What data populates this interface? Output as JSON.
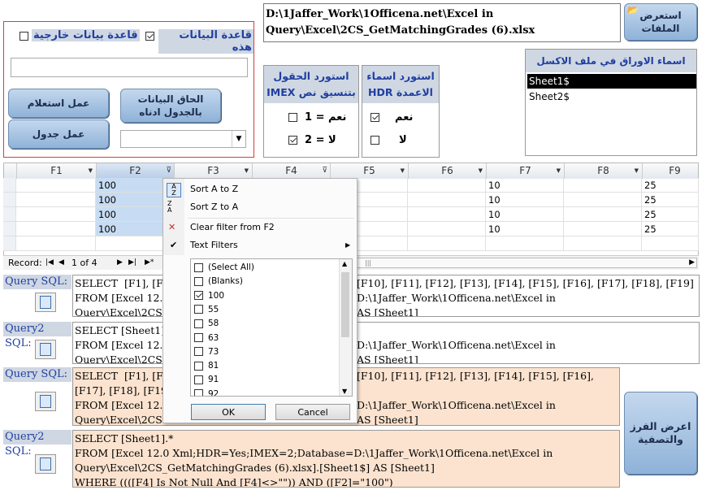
{
  "top": {
    "browse_button": "استعرض\nالملفات",
    "file_path": "D:\\1Jaffer_Work\\1Officena.net\\Excel in\nQuery\\Excel\\2CS_GetMatchingGrades (6).xlsx",
    "sheets_title": "اسماء الاوراق في ملف الاكسل",
    "sheets": [
      "Sheet1$",
      "Sheet2$"
    ]
  },
  "left_panel": {
    "this_db_label": "قاعدة البيانات هذه",
    "this_db_checked": true,
    "external_db_label": "قاعدة بيانات خارجية",
    "external_db_checked": false,
    "text_value": "",
    "append_button": "الحاق البيانات\nبالجدول ادناه",
    "query_button": "عمل استعلام",
    "table_button": "عمل جدول",
    "combo_value": ""
  },
  "hdr_group": {
    "title": "استورد اسماء\nالاعمدة HDR",
    "yes_label": "نعم",
    "yes_checked": true,
    "no_label": "لا",
    "no_checked": false
  },
  "imex_group": {
    "title": "استورد الحقول\nبتنسيق نص IMEX",
    "opt1_label": "نعم = 1",
    "opt1_checked": false,
    "opt2_label": "لا = 2",
    "opt2_checked": true
  },
  "grid": {
    "columns": [
      "F1",
      "F2",
      "F3",
      "F4",
      "F5",
      "F6",
      "F7",
      "F8",
      "F9"
    ],
    "rows": [
      {
        "F2": "100",
        "F7": "10",
        "F9": "25"
      },
      {
        "F2": "100",
        "F7": "10",
        "F9": "25"
      },
      {
        "F2": "100",
        "F7": "10",
        "F9": "25"
      },
      {
        "F2": "100",
        "F7": "10",
        "F9": "25"
      }
    ],
    "record_label": "Record:",
    "record_value": "1 of 4"
  },
  "filter_menu": {
    "sort_az": "Sort A to Z",
    "sort_za": "Sort Z to A",
    "clear_filter": "Clear filter from F2",
    "text_filters": "Text Filters",
    "values": [
      {
        "label": "(Select All)",
        "checked": false
      },
      {
        "label": "(Blanks)",
        "checked": false
      },
      {
        "label": "100",
        "checked": true
      },
      {
        "label": "55",
        "checked": false
      },
      {
        "label": "58",
        "checked": false
      },
      {
        "label": "63",
        "checked": false
      },
      {
        "label": "73",
        "checked": false
      },
      {
        "label": "81",
        "checked": false
      },
      {
        "label": "91",
        "checked": false
      },
      {
        "label": "92",
        "checked": false
      }
    ],
    "ok": "OK",
    "cancel": "Cancel"
  },
  "sql": [
    {
      "label": "Query SQL:",
      "left": "SELECT  [F1], [F\nFROM [Excel 12.0\nQuery\\Excel\\2CS",
      "right": "[F10], [F11], [F12], [F13], [F14], [F15], [F16], [F17], [F18], [F19]\nD:\\1Jaffer_Work\\1Officena.net\\Excel in\nAS [Sheet1]"
    },
    {
      "label": "Query2 SQL:",
      "left": "SELECT [Sheet1]\nFROM [Excel 12.0\nQuery\\Excel\\2CS",
      "right": "\nD:\\1Jaffer_Work\\1Officena.net\\Excel in\nAS [Sheet1]"
    },
    {
      "label": "Query SQL:",
      "left": "SELECT  [F1], [F\n[F17], [F18], [F19]\nFROM [Excel 12.0\nQuery\\Excel\\2CS",
      "right": "[F10], [F11], [F12], [F13], [F14], [F15], [F16],\n\nD:\\1Jaffer_Work\\1Officena.net\\Excel in\nAS [Sheet1]"
    },
    {
      "label": "Query2 SQL:",
      "text": "SELECT [Sheet1].*\nFROM [Excel 12.0 Xml;HDR=Yes;IMEX=2;Database=D:\\1Jaffer_Work\\1Officena.net\\Excel in\nQuery\\Excel\\2CS_GetMatchingGrades (6).xlsx].[Sheet1$] AS [Sheet1]\nWHERE ((([F4] Is Not Null And [F4]<>\"\")) AND ([F2]=\"100\")"
    }
  ],
  "show_sort_button": "اعرض الفرز\nوالتصفية",
  "colors": {
    "accent": "#8fb2d8",
    "sql_highlight": "#fbe3cf",
    "grid_selected": "#c7dcf2"
  }
}
